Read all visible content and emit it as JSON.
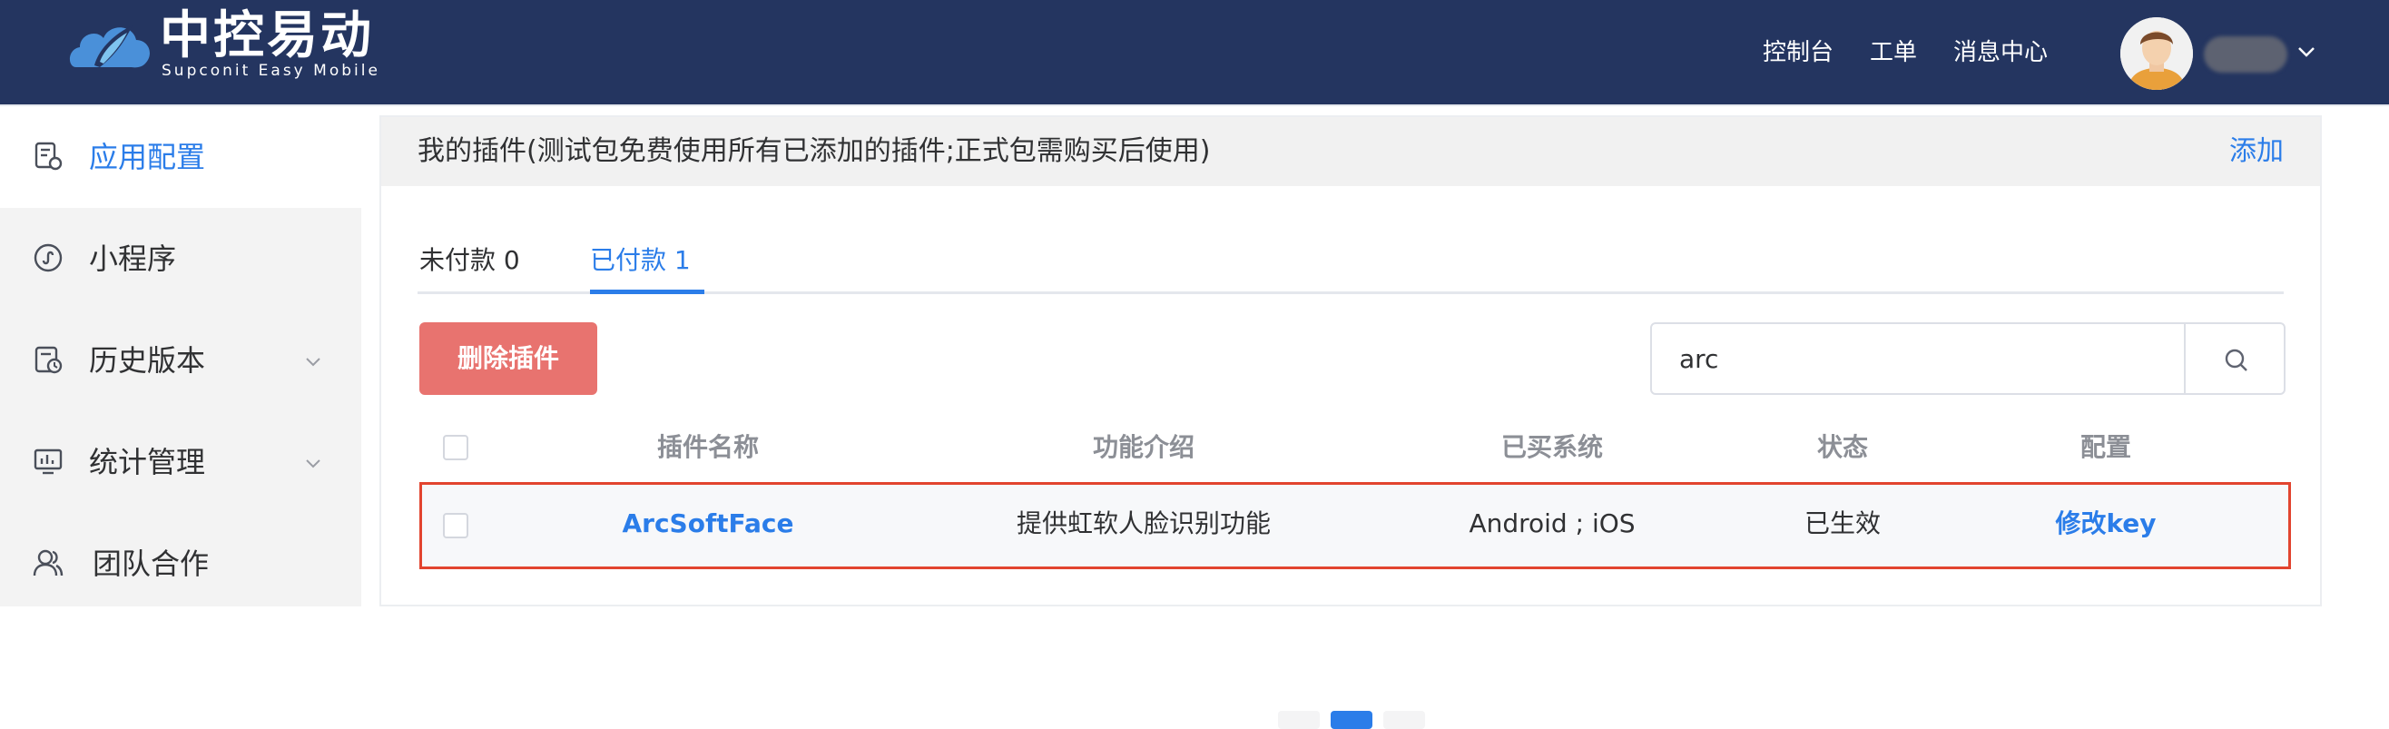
{
  "header": {
    "logo_title": "中控易动",
    "logo_subtitle": "Supconit Easy Mobile",
    "nav": [
      "控制台",
      "工单",
      "消息中心"
    ],
    "colors": {
      "background": "#243560",
      "accent": "#2b7de9"
    }
  },
  "sidebar": {
    "items": [
      {
        "label": "应用配置",
        "icon": "app-config-icon",
        "active": true
      },
      {
        "label": "小程序",
        "icon": "mini-program-icon",
        "active": false
      },
      {
        "label": "历史版本",
        "icon": "history-icon",
        "active": false,
        "expandable": true
      },
      {
        "label": "统计管理",
        "icon": "statistics-icon",
        "active": false,
        "expandable": true
      },
      {
        "label": "团队合作",
        "icon": "team-icon",
        "active": false
      }
    ]
  },
  "main": {
    "panel_title": "我的插件(测试包免费使用所有已添加的插件;正式包需购买后使用)",
    "add_label": "添加",
    "tabs": [
      {
        "label": "未付款 0",
        "active": false
      },
      {
        "label": "已付款 1",
        "active": true
      }
    ],
    "delete_button": "删除插件",
    "search": {
      "value": "arc",
      "icon": "search-icon"
    },
    "table": {
      "columns": [
        "插件名称",
        "功能介绍",
        "已买系统",
        "状态",
        "配置"
      ],
      "rows": [
        {
          "name": "ArcSoftFace",
          "description": "提供虹软人脸识别功能",
          "systems": "Android ; iOS",
          "status": "已生效",
          "action": "修改key",
          "highlighted": true
        }
      ]
    },
    "colors": {
      "delete": "#e8736f",
      "highlight_border": "#e2442f"
    }
  }
}
